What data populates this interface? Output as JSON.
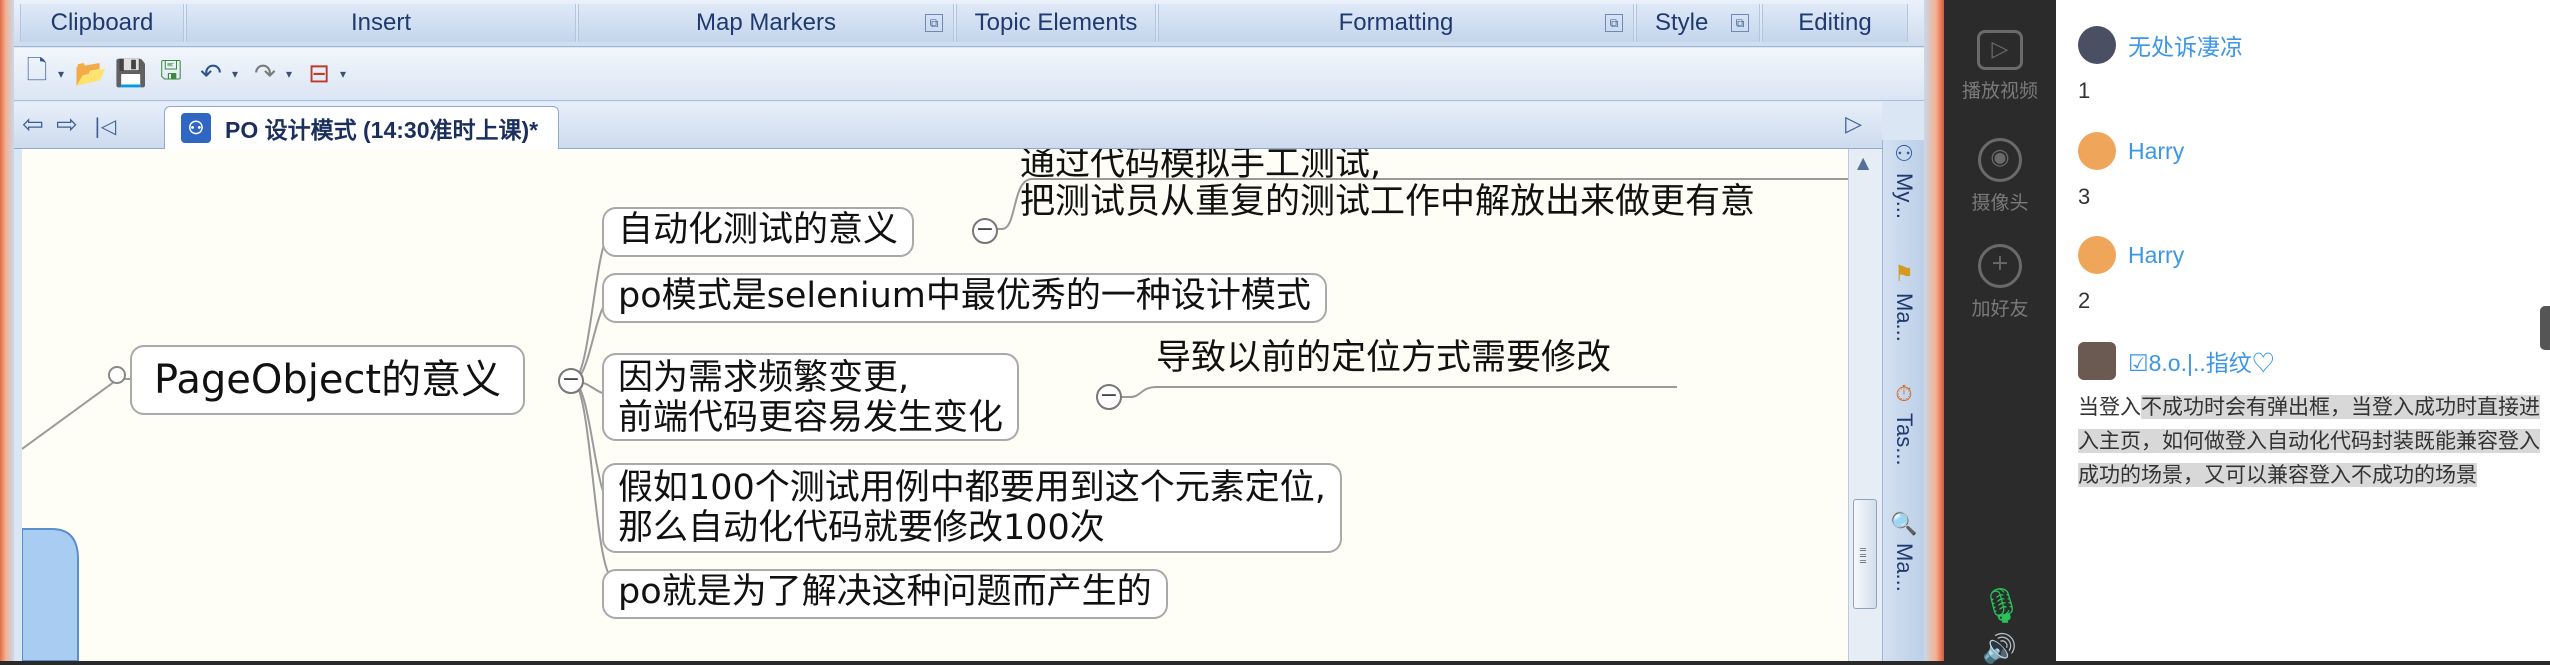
{
  "ribbon": {
    "groups": [
      {
        "label": "Clipboard"
      },
      {
        "label": "Insert"
      },
      {
        "label": "Map Markers"
      },
      {
        "label": "Topic Elements"
      },
      {
        "label": "Formatting"
      },
      {
        "label": "Style"
      },
      {
        "label": "Editing"
      }
    ],
    "launcher_glyph": "⧉"
  },
  "quick_access": [
    {
      "icon": "new-document-icon",
      "glyph": "🗋"
    },
    {
      "icon": "open-folder-icon",
      "glyph": "📂"
    },
    {
      "icon": "save-icon",
      "glyph": "💾"
    },
    {
      "icon": "save-all-icon",
      "glyph": "🖫"
    },
    {
      "icon": "undo-icon",
      "glyph": "↶"
    },
    {
      "icon": "redo-icon",
      "glyph": "↷"
    },
    {
      "icon": "topic-tool-icon",
      "glyph": "⊟"
    }
  ],
  "tab": {
    "title": "PO 设计模式 (14:30准时上课)*"
  },
  "mindmap": {
    "central": "PageObject的意义",
    "topics": [
      {
        "text": "自动化测试的意义"
      },
      {
        "text": "po模式是selenium中最优秀的一种设计模式"
      },
      {
        "line1": "因为需求频繁变更,",
        "line2": "前端代码更容易发生变化"
      },
      {
        "line1": "假如100个测试用例中都要用到这个元素定位,",
        "line2": "那么自动化代码就要修改100次"
      },
      {
        "text": "po就是为了解决这种问题而产生的"
      }
    ],
    "subtopics": {
      "meaning_line1": "通过代码模拟手工测试,",
      "meaning_line2": "把测试员从重复的测试工作中解放出来做更有意",
      "change_result": "导致以前的定位方式需要修改"
    },
    "collapse_glyph": "−"
  },
  "side_panel": [
    {
      "label": "My...",
      "icon": "my-map-icon",
      "glyph": "⚇"
    },
    {
      "label": "Ma...",
      "icon": "markers-icon",
      "glyph": "⚑"
    },
    {
      "label": "Tas...",
      "icon": "task-icon",
      "glyph": "⏱"
    },
    {
      "label": "Ma...",
      "icon": "map-search-icon",
      "glyph": "🔍"
    }
  ],
  "video_tools": [
    {
      "label": "播放视频",
      "glyph": "▷"
    },
    {
      "label": "摄像头",
      "glyph": "◉"
    },
    {
      "label": "加好友",
      "glyph": "+"
    }
  ],
  "chat": {
    "messages": [
      {
        "user": "无处诉凄凉",
        "text": "1",
        "avatar_color": "#4a4f63"
      },
      {
        "user": "Harry",
        "text": "3",
        "avatar_color": "#f0a65a"
      },
      {
        "user": "Harry",
        "text": "2",
        "avatar_color": "#f0a65a"
      }
    ],
    "last_user": "☑8.o.|..指纹♡",
    "last_avatar_color": "#6b5a52",
    "long_message": {
      "prefix": "当登入",
      "highlighted": "不成功时会有弹出框，当登入成功时直接进入主页，如何做登入自动化代码封装既能兼容登入成功的场景，又可以兼容登入不成功的场景"
    }
  }
}
